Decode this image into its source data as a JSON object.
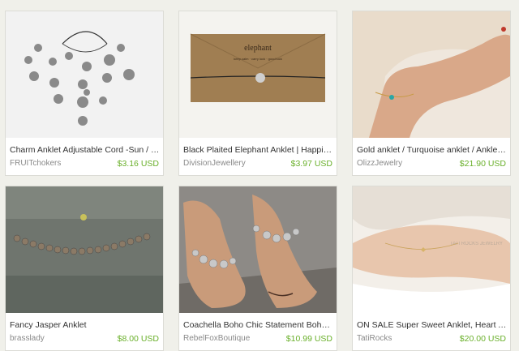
{
  "listings": [
    {
      "title": "Charm Anklet Adjustable Cord -Sun / Moon / Stars Charms",
      "shop": "FRUITchokers",
      "price": "$3.16 USD"
    },
    {
      "title": "Black Plaited Elephant Anklet | Happiness & Luck",
      "shop": "DivisionJewellery",
      "price": "$3.97 USD"
    },
    {
      "title": "Gold anklet / Turquoise anklet / Ankle bracelet",
      "shop": "OlizzJewelry",
      "price": "$21.90 USD"
    },
    {
      "title": "Fancy Jasper Anklet",
      "shop": "brasslady",
      "price": "$8.00 USD"
    },
    {
      "title": "Coachella Boho Chic Statement Boho Anklet",
      "shop": "RebelFoxBoutique",
      "price": "$10.99 USD"
    },
    {
      "title": "ON SALE Super Sweet Anklet, Heart Anklet",
      "shop": "TatiRocks",
      "price": "$20.00 USD"
    }
  ],
  "image_texts": {
    "elephant_packaging": "elephant",
    "elephant_tagline": "keep calm · carry luck · good luck",
    "watermark": "TATI ROCKS JEWELRY"
  },
  "colors": {
    "price": "#6ab02b",
    "title": "#333333",
    "shop": "#8a8a8a",
    "page_bg": "#f0f0ea"
  }
}
